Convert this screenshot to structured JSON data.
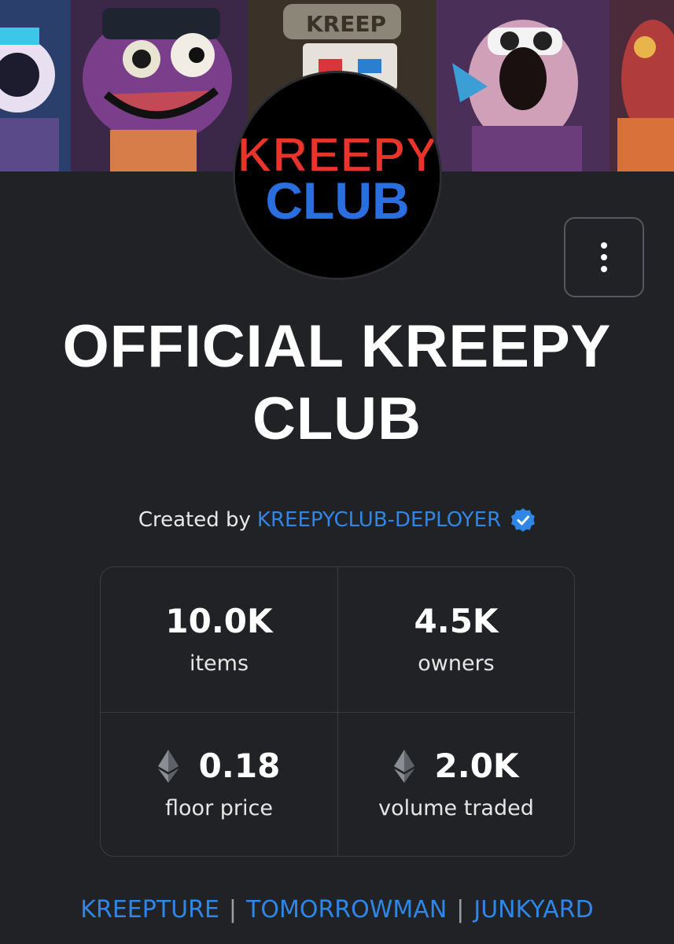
{
  "collection": {
    "title": "OFFICIAL KREEPY CLUB",
    "logo_text_line1": "KREEPY",
    "logo_text_line2": "CLUB",
    "banner_text": "KREEP"
  },
  "creator": {
    "prefix": "Created by",
    "name": "KREEPYCLUB-DEPLOYER",
    "verified_icon": "verified-badge-icon"
  },
  "stats": {
    "items_value": "10.0K",
    "items_label": "items",
    "owners_value": "4.5K",
    "owners_label": "owners",
    "floor_value": "0.18",
    "floor_label": "floor price",
    "volume_value": "2.0K",
    "volume_label": "volume traded",
    "currency_icon": "ethereum-icon"
  },
  "links": {
    "link1": "KREEPTURE",
    "link2": "TOMORROWMAN",
    "link3": "JUNKYARD",
    "separator": "|"
  },
  "colors": {
    "background": "#202225",
    "link": "#2f86e6",
    "border": "#3a3d42"
  }
}
